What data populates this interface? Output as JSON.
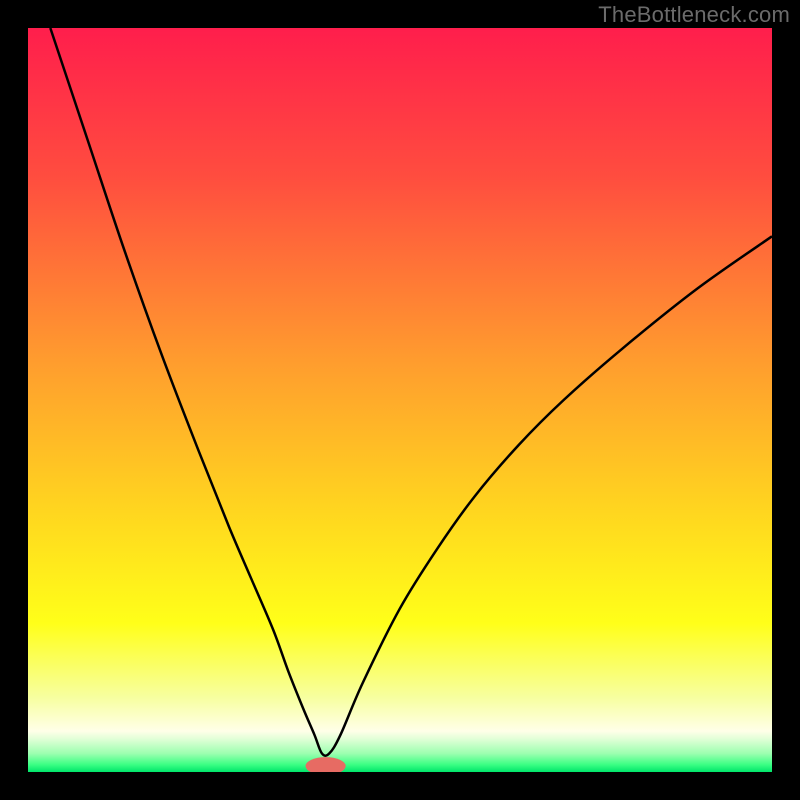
{
  "watermark": "TheBottleneck.com",
  "chart_data": {
    "type": "line",
    "title": "",
    "xlabel": "",
    "ylabel": "",
    "xlim": [
      0,
      100
    ],
    "ylim": [
      0,
      100
    ],
    "gradient_stops": [
      {
        "offset": 0.0,
        "color": "#ff1e4c"
      },
      {
        "offset": 0.2,
        "color": "#ff4d3f"
      },
      {
        "offset": 0.45,
        "color": "#ff9d2e"
      },
      {
        "offset": 0.65,
        "color": "#ffd61f"
      },
      {
        "offset": 0.8,
        "color": "#ffff19"
      },
      {
        "offset": 0.9,
        "color": "#f7ffa0"
      },
      {
        "offset": 0.945,
        "color": "#ffffe8"
      },
      {
        "offset": 0.955,
        "color": "#e3ffd8"
      },
      {
        "offset": 0.975,
        "color": "#9dffb0"
      },
      {
        "offset": 0.99,
        "color": "#3cff84"
      },
      {
        "offset": 1.0,
        "color": "#00e56a"
      }
    ],
    "series": [
      {
        "name": "curve",
        "x": [
          3,
          8,
          13,
          18,
          23,
          27,
          30,
          33,
          35,
          37,
          38.5,
          39.5,
          40.5,
          42,
          45,
          50,
          55,
          60,
          66,
          72,
          80,
          90,
          100
        ],
        "y": [
          100,
          85,
          70,
          56,
          43,
          33,
          26,
          19,
          13.5,
          8.5,
          5,
          2.5,
          2.5,
          5,
          12,
          22,
          30,
          37,
          44,
          50,
          57,
          65,
          72
        ]
      }
    ],
    "optimal_marker": {
      "x": 40,
      "y": 0.8,
      "rx": 2.7,
      "ry": 1.2,
      "color": "#e76b63"
    }
  }
}
